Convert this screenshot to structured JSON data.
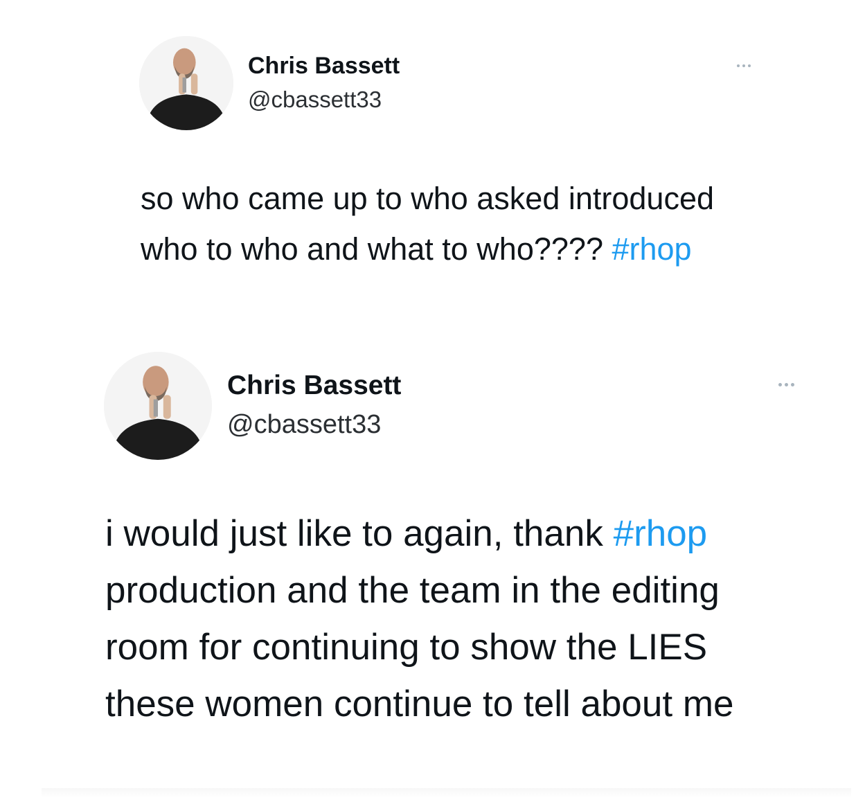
{
  "tweets": [
    {
      "author": {
        "display_name": "Chris Bassett",
        "handle": "@cbassett33"
      },
      "text_before": "so who came up to who asked introduced who to who and what to who???? ",
      "hashtag": "#rhop",
      "text_after": ""
    },
    {
      "author": {
        "display_name": "Chris Bassett",
        "handle": "@cbassett33"
      },
      "text_before": "i would just like to again, thank ",
      "hashtag": "#rhop",
      "text_after": " production and the team in the editing room for continuing to show the LIES these women continue to tell about me"
    }
  ],
  "colors": {
    "hashtag": "#1d9bf0",
    "text": "#0f1419",
    "more_dots": "#a8b4be"
  },
  "icons": {
    "more": "more-horizontal-icon"
  }
}
